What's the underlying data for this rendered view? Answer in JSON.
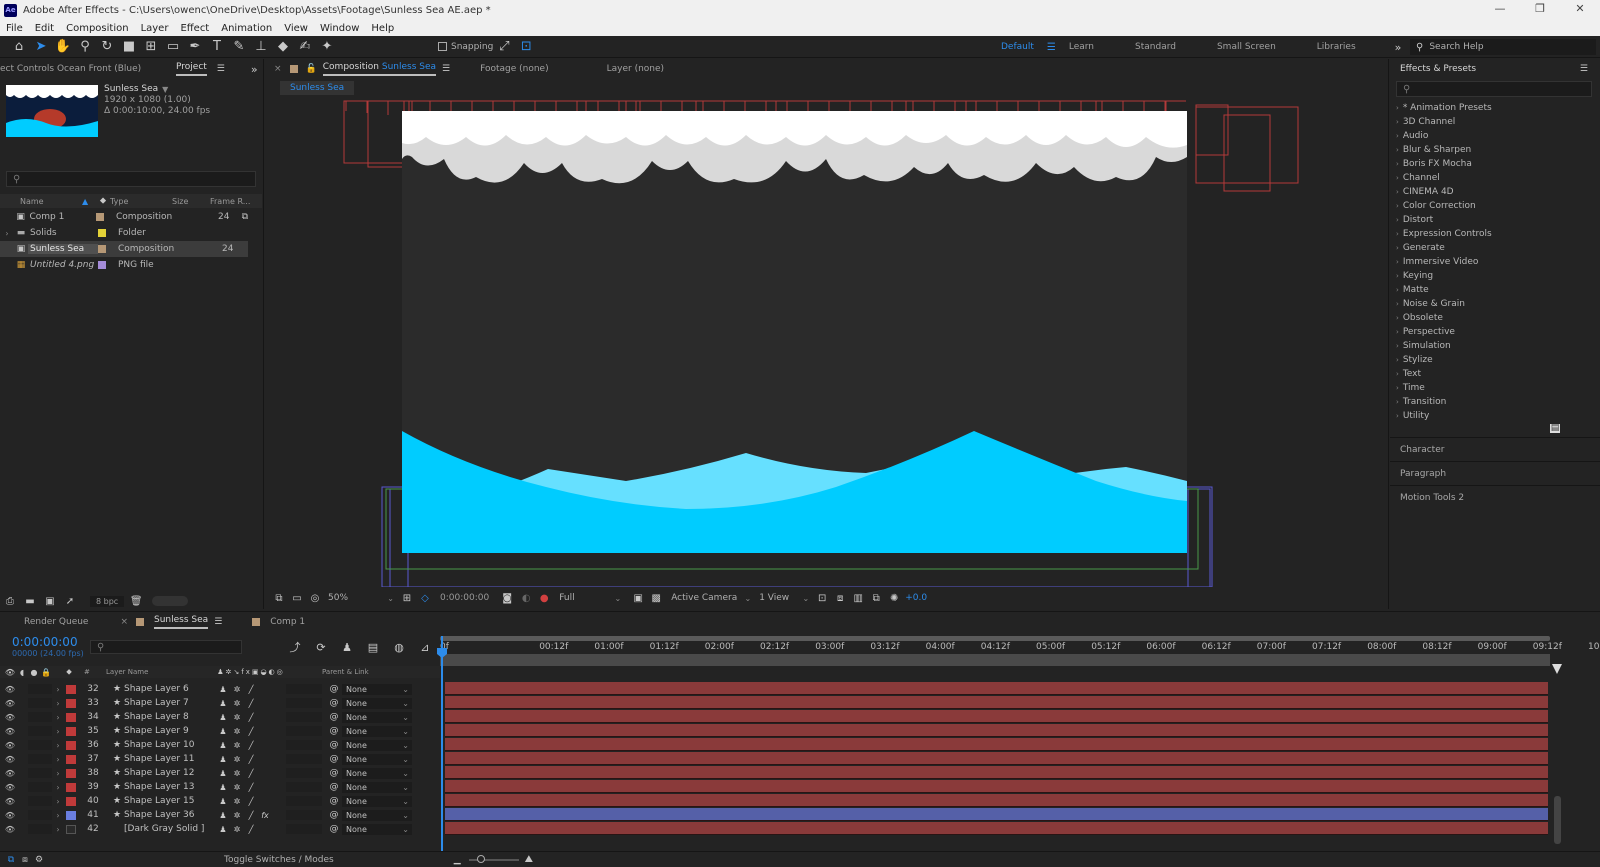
{
  "window": {
    "app_abbrev": "Ae",
    "title": "Adobe After Effects - C:\\Users\\owenc\\OneDrive\\Desktop\\Assets\\Footage\\Sunless Sea AE.aep *"
  },
  "menu": [
    "File",
    "Edit",
    "Composition",
    "Layer",
    "Effect",
    "Animation",
    "View",
    "Window",
    "Help"
  ],
  "toolbar": {
    "snapping": "Snapping",
    "workspaces": [
      "Default",
      "Learn",
      "Standard",
      "Small Screen",
      "Libraries"
    ],
    "active_workspace": "Default",
    "search_help": "Search Help"
  },
  "project": {
    "tabs": {
      "effect_controls": "ect Controls Ocean Front (Blue)",
      "project": "Project"
    },
    "preview": {
      "name": "Sunless Sea",
      "dims": "1920 x 1080 (1.00)",
      "duration": "Δ 0:00:10:00, 24.00 fps"
    },
    "columns": {
      "name": "Name",
      "type": "Type",
      "size": "Size",
      "frame_rate": "Frame R..."
    },
    "items": [
      {
        "name": "Comp 1",
        "type": "Composition",
        "rate": "24",
        "color": "#b69876"
      },
      {
        "name": "Solids",
        "type": "Folder",
        "rate": "",
        "color": "#e3d237"
      },
      {
        "name": "Sunless Sea",
        "type": "Composition",
        "rate": "24",
        "color": "#b69876"
      },
      {
        "name": "Untitled 4.png",
        "type": "PNG file",
        "rate": "",
        "color": "#a58cd9"
      }
    ],
    "bpc": "8 bpc"
  },
  "viewer": {
    "tabs": {
      "composition_prefix": "Composition",
      "composition_name": "Sunless Sea",
      "footage": "Footage (none)",
      "layer": "Layer (none)"
    },
    "subtab": "Sunless Sea",
    "zoom": "50%",
    "timecode": "0:00:00:00",
    "resolution": "Full",
    "camera": "Active Camera",
    "views": "1 View",
    "exposure": "+0.0",
    "colors": {
      "sky": "#ffffff",
      "cloud": "#d9d9d9",
      "sea_front": "#00ccff",
      "sea_back": "#66e0ff",
      "bg": "#2b2b2b"
    }
  },
  "effects": {
    "title": "Effects & Presets",
    "items": [
      "* Animation Presets",
      "3D Channel",
      "Audio",
      "Blur & Sharpen",
      "Boris FX Mocha",
      "Channel",
      "CINEMA 4D",
      "Color Correction",
      "Distort",
      "Expression Controls",
      "Generate",
      "Immersive Video",
      "Keying",
      "Matte",
      "Noise & Grain",
      "Obsolete",
      "Perspective",
      "Simulation",
      "Stylize",
      "Text",
      "Time",
      "Transition",
      "Utility"
    ],
    "panels": [
      "Character",
      "Paragraph",
      "Motion Tools 2"
    ]
  },
  "timeline": {
    "tabs": {
      "render_queue": "Render Queue",
      "active": "Sunless Sea",
      "other": "Comp 1"
    },
    "timecode": "0:00:00:00",
    "frame_info": "00000 (24.00 fps)",
    "columns": {
      "layer_name": "Layer Name",
      "parent": "Parent & Link",
      "hash": "#"
    },
    "ruler": [
      "0f",
      "00:12f",
      "01:00f",
      "01:12f",
      "02:00f",
      "02:12f",
      "03:00f",
      "03:12f",
      "04:00f",
      "04:12f",
      "05:00f",
      "05:12f",
      "06:00f",
      "06:12f",
      "07:00f",
      "07:12f",
      "08:00f",
      "08:12f",
      "09:00f",
      "09:12f",
      "10:0"
    ],
    "layers": [
      {
        "num": "32",
        "name": "Shape Layer 6",
        "parent": "None",
        "color": "#c03a3a"
      },
      {
        "num": "33",
        "name": "Shape Layer 7",
        "parent": "None",
        "color": "#c03a3a"
      },
      {
        "num": "34",
        "name": "Shape Layer 8",
        "parent": "None",
        "color": "#c03a3a"
      },
      {
        "num": "35",
        "name": "Shape Layer 9",
        "parent": "None",
        "color": "#c03a3a"
      },
      {
        "num": "36",
        "name": "Shape Layer 10",
        "parent": "None",
        "color": "#c03a3a"
      },
      {
        "num": "37",
        "name": "Shape Layer 11",
        "parent": "None",
        "color": "#c03a3a"
      },
      {
        "num": "38",
        "name": "Shape Layer 12",
        "parent": "None",
        "color": "#c03a3a"
      },
      {
        "num": "39",
        "name": "Shape Layer 13",
        "parent": "None",
        "color": "#c03a3a"
      },
      {
        "num": "40",
        "name": "Shape Layer 15",
        "parent": "None",
        "color": "#c03a3a"
      },
      {
        "num": "41",
        "name": "Shape Layer 36",
        "parent": "None",
        "color": "#6a7ee0",
        "fx": "fx"
      },
      {
        "num": "42",
        "name": "[Dark Gray Solid ]",
        "parent": "None",
        "color": "#2a2a2a"
      }
    ],
    "toggle_label": "Toggle Switches / Modes"
  }
}
